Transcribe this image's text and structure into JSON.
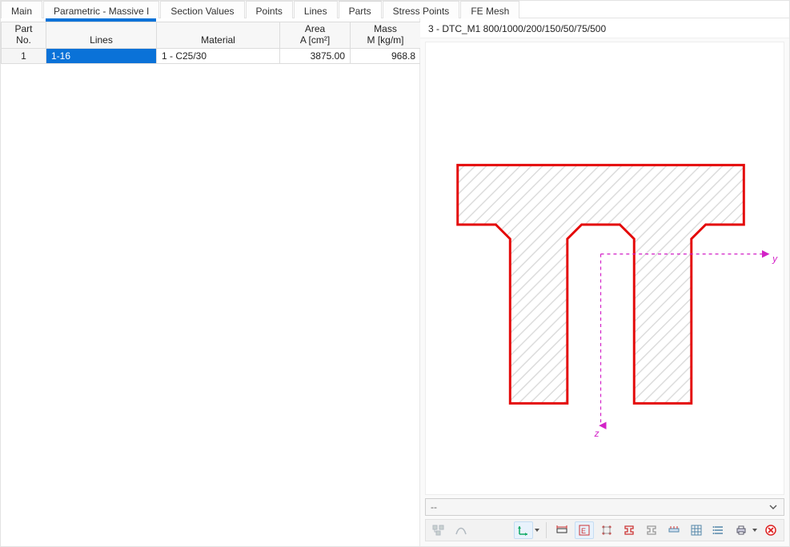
{
  "tabs": [
    {
      "label": "Main"
    },
    {
      "label": "Parametric - Massive I"
    },
    {
      "label": "Section Values"
    },
    {
      "label": "Points"
    },
    {
      "label": "Lines"
    },
    {
      "label": "Parts",
      "active": true
    },
    {
      "label": "Stress Points"
    },
    {
      "label": "FE Mesh"
    }
  ],
  "table": {
    "headers": {
      "part_no": {
        "l1": "Part",
        "l2": "No."
      },
      "lines": "Lines",
      "material": "Material",
      "area": {
        "l1": "Area",
        "l2": "A [cm²]"
      },
      "mass": {
        "l1": "Mass",
        "l2": "M [kg/m]"
      }
    },
    "rows": [
      {
        "no": "1",
        "lines": "1-16",
        "material": "1 - C25/30",
        "area": "3875.00",
        "mass": "968.8"
      }
    ]
  },
  "right": {
    "title": "3 - DTC_M1 800/1000/200/150/50/75/500",
    "axes": {
      "y": "y",
      "z": "z"
    },
    "dropdown_text": "--"
  },
  "toolbar": {
    "icons": [
      "toggle-tree-icon",
      "curve-icon",
      "sep",
      "spacer",
      "axes-icon",
      "sep",
      "dimension-icon",
      "values-icon",
      "points-icon",
      "ibeam-red-icon",
      "ibeam-grey-icon",
      "stress-icon",
      "grid-icon",
      "list-icon",
      "print-icon",
      "close-red-icon"
    ]
  },
  "colors": {
    "accent_blue": "#0a72d8",
    "section_outline": "#e40a0a",
    "hatch": "#e8e8e8",
    "axis": "#d322c7"
  }
}
